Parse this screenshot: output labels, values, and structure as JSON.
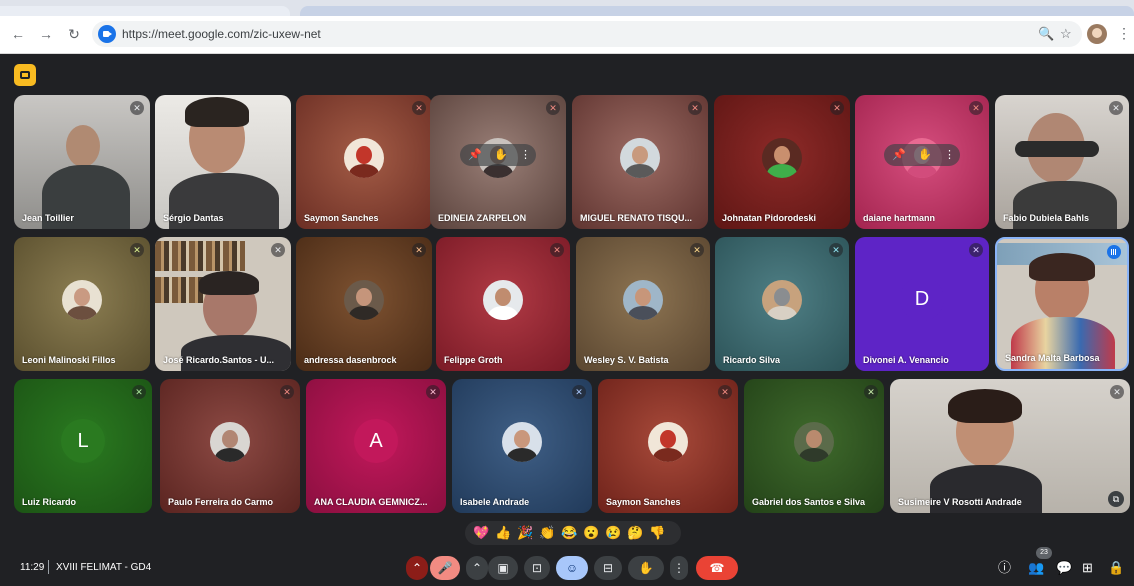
{
  "browser": {
    "url": "https://meet.google.com/zic-uxew-net",
    "icons": [
      "back-arrow-icon",
      "forward-arrow-icon",
      "reload-icon",
      "zoom-icon",
      "bookmark-star-icon",
      "profile-avatar",
      "kebab-menu-icon"
    ]
  },
  "participants": [
    {
      "name": "Jean Toillier",
      "mic": "muted-neutral"
    },
    {
      "name": "Sérgio Dantas",
      "mic": "none"
    },
    {
      "name": "Saymon Sanches",
      "mic": "muted"
    },
    {
      "name": "EDINEIA ZARPELON",
      "mic": "muted"
    },
    {
      "name": "MIGUEL RENATO TISQU...",
      "mic": "muted"
    },
    {
      "name": "Johnatan Pidorodeski",
      "mic": "muted"
    },
    {
      "name": "daiane hartmann",
      "mic": "muted"
    },
    {
      "name": "Fabio Dubiela Bahls",
      "mic": "muted-neutral"
    },
    {
      "name": "Leoni Malinoski Fillos",
      "mic": "muted"
    },
    {
      "name": "José Ricardo.Santos - U...",
      "mic": "muted-neutral"
    },
    {
      "name": "andressa dasenbrock",
      "mic": "muted"
    },
    {
      "name": "Felippe Groth",
      "mic": "muted"
    },
    {
      "name": "Wesley S. V. Batista",
      "mic": "muted"
    },
    {
      "name": "Ricardo Silva",
      "mic": "muted"
    },
    {
      "name": "Divonei A. Venancio",
      "mic": "muted",
      "initial": "D"
    },
    {
      "name": "Sandra Malta Barbosa",
      "mic": "speaking"
    },
    {
      "name": "Luiz Ricardo",
      "mic": "muted",
      "initial": "L"
    },
    {
      "name": "Paulo Ferreira do Carmo",
      "mic": "muted"
    },
    {
      "name": "ANA CLAUDIA GEMNICZ...",
      "mic": "muted",
      "initial": "A"
    },
    {
      "name": "Isabele Andrade",
      "mic": "muted"
    },
    {
      "name": "Saymon Sanches",
      "mic": "muted"
    },
    {
      "name": "Gabriel dos Santos e Silva",
      "mic": "muted"
    },
    {
      "name": "Susimeire V Rosotti Andrade",
      "mic": "muted-neutral"
    }
  ],
  "reactions": [
    "💖",
    "👍",
    "🎉",
    "👏",
    "😂",
    "😮",
    "😢",
    "🤔",
    "👎"
  ],
  "bottom_bar": {
    "time": "11:29",
    "meeting_name": "XVIII FELIMAT - GD4",
    "participant_count": "23",
    "controls": [
      "chevron-up-icon",
      "mic-off-icon",
      "chevron-up-icon",
      "camera-icon",
      "present-screen-icon",
      "emoji-icon",
      "captions-icon",
      "raise-hand-icon",
      "more-options-icon",
      "end-call-icon"
    ],
    "right_controls": [
      "info-icon",
      "people-icon",
      "chat-icon",
      "activities-icon",
      "host-controls-icon"
    ]
  },
  "colors": {
    "background": "#202124",
    "muted_mic": "#f28b82",
    "speaking": "#1a73e8",
    "end_call": "#ea4335",
    "meet_badge": "#f9bb21"
  }
}
